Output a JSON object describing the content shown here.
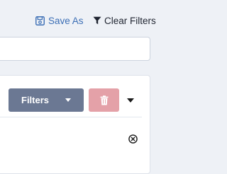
{
  "toolbar": {
    "save_as_label": "Save As",
    "clear_filters_label": "Clear Filters"
  },
  "search": {
    "value": "",
    "placeholder": ""
  },
  "filter_panel": {
    "filters_button_label": "Filters"
  },
  "colors": {
    "link_blue": "#3b6eb5",
    "filters_button_bg": "#6b7893",
    "delete_button_bg": "#e4a1a8",
    "page_bg": "#eef1f6"
  },
  "icons": {
    "save": "floppy-disk-icon",
    "clear_filters": "funnel-icon",
    "delete": "trash-icon",
    "dropdown": "chevron-down-icon",
    "remove": "circle-x-icon"
  }
}
